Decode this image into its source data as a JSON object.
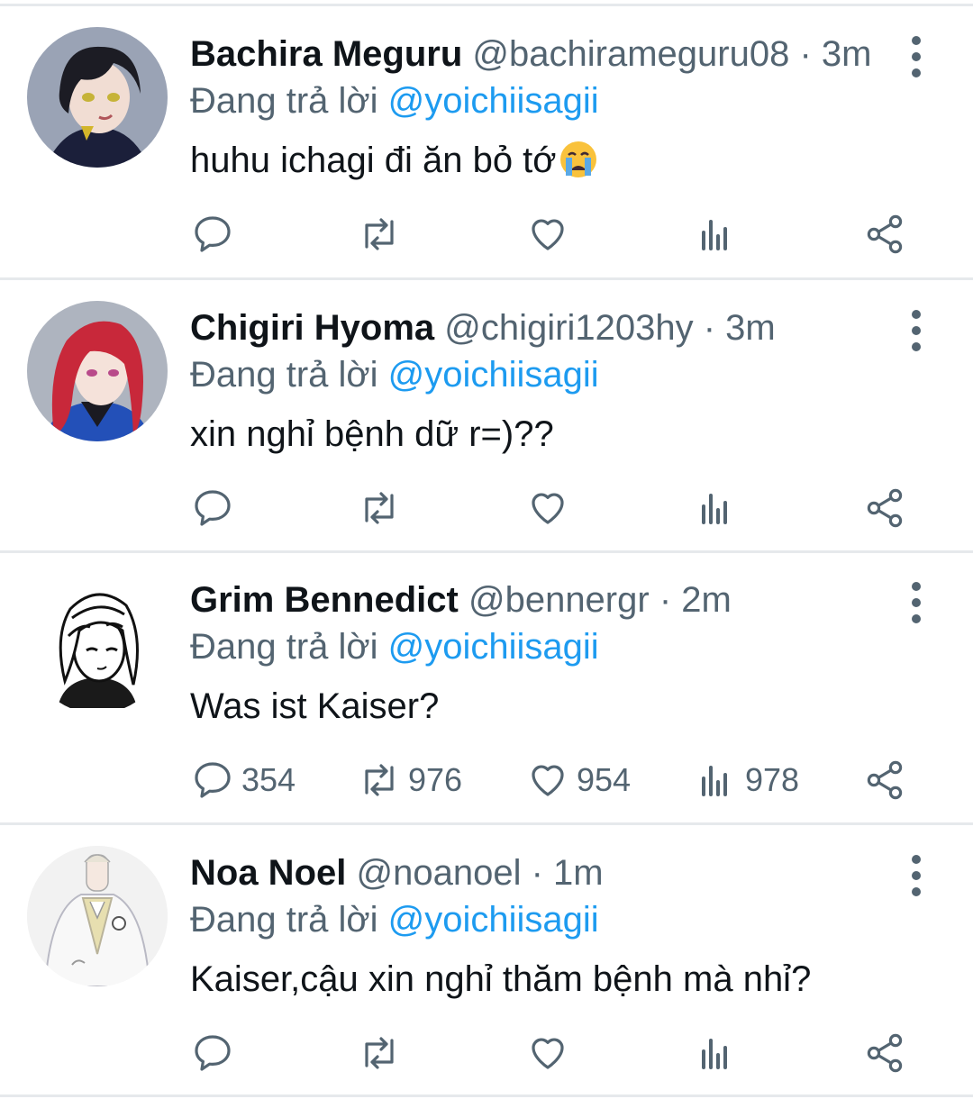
{
  "colors": {
    "accent": "#1d9bf0",
    "muted": "#536471",
    "text": "#0f1419",
    "divider": "#e6e9ec"
  },
  "tweets": [
    {
      "name": "Bachira Meguru",
      "handle": "@bachirameguru08",
      "sep": "·",
      "time": "3m",
      "reply_prefix": "Đang trả lời ",
      "reply_to": "@yoichiisagii",
      "text": "huhu ichagi đi ăn bỏ tớ",
      "emoji": "loudly-crying-face",
      "counts": {
        "reply": "",
        "retweet": "",
        "like": "",
        "views": ""
      }
    },
    {
      "name": "Chigiri Hyoma",
      "handle": "@chigiri1203hy",
      "sep": "·",
      "time": "3m",
      "reply_prefix": "Đang trả lời ",
      "reply_to": "@yoichiisagii",
      "text": "xin nghỉ bệnh dữ r=)??",
      "counts": {
        "reply": "",
        "retweet": "",
        "like": "",
        "views": ""
      }
    },
    {
      "name": "Grim Bennedict",
      "handle": "@bennergr",
      "sep": "·",
      "time": "2m",
      "reply_prefix": "Đang trả lời ",
      "reply_to": "@yoichiisagii",
      "text": "Was ist Kaiser?",
      "counts": {
        "reply": "354",
        "retweet": "976",
        "like": "954",
        "views": "978"
      }
    },
    {
      "name": "Noa Noel",
      "handle": "@noanoel",
      "sep": "·",
      "time": "1m",
      "reply_prefix": "Đang trả lời ",
      "reply_to": "@yoichiisagii",
      "text": "Kaiser,cậu xin nghỉ thăm bệnh mà nhỉ?",
      "counts": {
        "reply": "",
        "retweet": "",
        "like": "",
        "views": ""
      }
    }
  ]
}
